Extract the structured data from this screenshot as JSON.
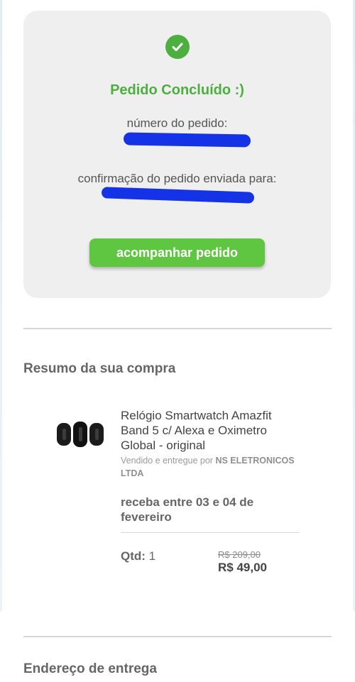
{
  "order": {
    "title": "Pedido Concluído :)",
    "number_label": "número do pedido:",
    "confirmation_label": "confirmação do pedido enviada para:",
    "track_button": "acompanhar pedido"
  },
  "summary": {
    "title": "Resumo da sua compra",
    "product": {
      "name": "Relógio Smartwatch Amazfit Band 5 c/ Alexa e Oximetro Global - original",
      "seller_prefix": "Vendido e entregue por",
      "seller_name": "NS ELETRONICOS LTDA",
      "delivery": "receba entre 03 e 04 de fevereiro",
      "qty_label": "Qtd:",
      "qty_value": "1",
      "old_price": "R$ 209,00",
      "new_price": "R$ 49,00"
    }
  },
  "address": {
    "title": "Endereço de entrega"
  },
  "colors": {
    "success_green": "#4caf3f",
    "button_green": "#5fc641",
    "redaction_blue": "#1433e6"
  },
  "icons": {
    "status": "check-circle-icon",
    "product": "smartwatch-band-image"
  }
}
